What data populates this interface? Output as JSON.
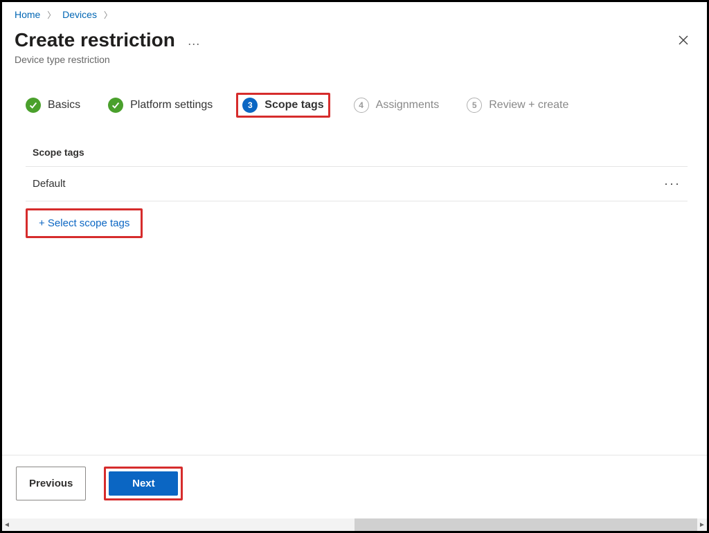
{
  "breadcrumb": {
    "home": "Home",
    "devices": "Devices"
  },
  "header": {
    "title": "Create restriction",
    "subtitle": "Device type restriction"
  },
  "steps": {
    "basics": "Basics",
    "platform": "Platform settings",
    "scope_num": "3",
    "scope": "Scope tags",
    "assign_num": "4",
    "assign": "Assignments",
    "review_num": "5",
    "review": "Review + create"
  },
  "section": {
    "heading": "Scope tags",
    "default_row": "Default",
    "select_link": "+ Select scope tags"
  },
  "footer": {
    "previous": "Previous",
    "next": "Next"
  }
}
